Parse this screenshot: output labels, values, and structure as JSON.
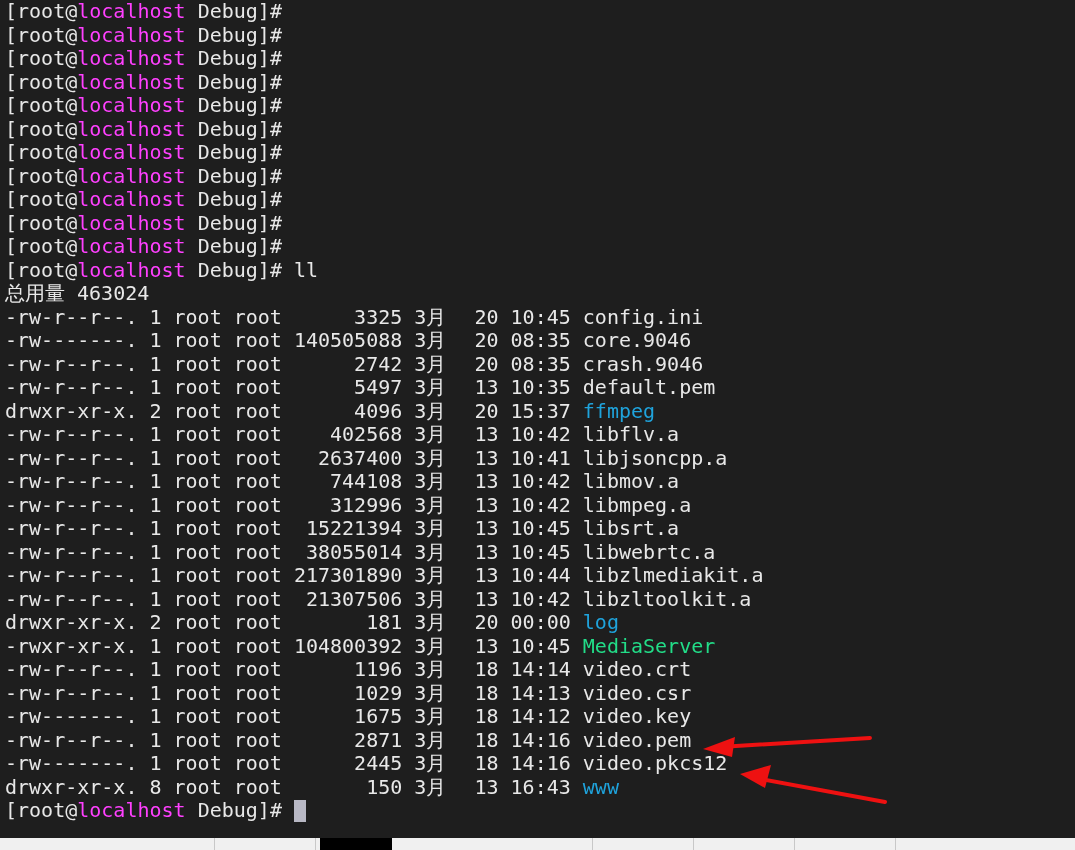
{
  "terminal": {
    "lines": [
      {
        "kind": "prompt",
        "before": "[root@",
        "host": "localhost",
        "after": " Debug]#"
      },
      {
        "kind": "prompt",
        "before": "[root@",
        "host": "localhost",
        "after": " Debug]#"
      },
      {
        "kind": "prompt",
        "before": "[root@",
        "host": "localhost",
        "after": " Debug]#"
      },
      {
        "kind": "prompt",
        "before": "[root@",
        "host": "localhost",
        "after": " Debug]#"
      },
      {
        "kind": "prompt",
        "before": "[root@",
        "host": "localhost",
        "after": " Debug]#"
      },
      {
        "kind": "prompt",
        "before": "[root@",
        "host": "localhost",
        "after": " Debug]#"
      },
      {
        "kind": "prompt",
        "before": "[root@",
        "host": "localhost",
        "after": " Debug]#"
      },
      {
        "kind": "prompt",
        "before": "[root@",
        "host": "localhost",
        "after": " Debug]#"
      },
      {
        "kind": "prompt",
        "before": "[root@",
        "host": "localhost",
        "after": " Debug]#"
      },
      {
        "kind": "prompt",
        "before": "[root@",
        "host": "localhost",
        "after": " Debug]#"
      },
      {
        "kind": "prompt",
        "before": "[root@",
        "host": "localhost",
        "after": " Debug]#"
      },
      {
        "kind": "prompt",
        "before": "[root@",
        "host": "localhost",
        "after": " Debug]#",
        "command": "ll"
      },
      {
        "kind": "total",
        "text": "总用量 463024"
      },
      {
        "kind": "file",
        "perms": "-rw-r--r--.",
        "links": "1",
        "owner": "root",
        "group": "root",
        "size": "3325",
        "month": "3月",
        "day": "20",
        "time": "10:45",
        "name": "config.ini",
        "color": "#e8e8e8"
      },
      {
        "kind": "file",
        "perms": "-rw-------.",
        "links": "1",
        "owner": "root",
        "group": "root",
        "size": "140505088",
        "month": "3月",
        "day": "20",
        "time": "08:35",
        "name": "core.9046",
        "color": "#e8e8e8"
      },
      {
        "kind": "file",
        "perms": "-rw-r--r--.",
        "links": "1",
        "owner": "root",
        "group": "root",
        "size": "2742",
        "month": "3月",
        "day": "20",
        "time": "08:35",
        "name": "crash.9046",
        "color": "#e8e8e8"
      },
      {
        "kind": "file",
        "perms": "-rw-r--r--.",
        "links": "1",
        "owner": "root",
        "group": "root",
        "size": "5497",
        "month": "3月",
        "day": "13",
        "time": "10:35",
        "name": "default.pem",
        "color": "#e8e8e8"
      },
      {
        "kind": "file",
        "perms": "drwxr-xr-x.",
        "links": "2",
        "owner": "root",
        "group": "root",
        "size": "4096",
        "month": "3月",
        "day": "20",
        "time": "15:37",
        "name": "ffmpeg",
        "color": "#1fa3dc"
      },
      {
        "kind": "file",
        "perms": "-rw-r--r--.",
        "links": "1",
        "owner": "root",
        "group": "root",
        "size": "402568",
        "month": "3月",
        "day": "13",
        "time": "10:42",
        "name": "libflv.a",
        "color": "#e8e8e8"
      },
      {
        "kind": "file",
        "perms": "-rw-r--r--.",
        "links": "1",
        "owner": "root",
        "group": "root",
        "size": "2637400",
        "month": "3月",
        "day": "13",
        "time": "10:41",
        "name": "libjsoncpp.a",
        "color": "#e8e8e8"
      },
      {
        "kind": "file",
        "perms": "-rw-r--r--.",
        "links": "1",
        "owner": "root",
        "group": "root",
        "size": "744108",
        "month": "3月",
        "day": "13",
        "time": "10:42",
        "name": "libmov.a",
        "color": "#e8e8e8"
      },
      {
        "kind": "file",
        "perms": "-rw-r--r--.",
        "links": "1",
        "owner": "root",
        "group": "root",
        "size": "312996",
        "month": "3月",
        "day": "13",
        "time": "10:42",
        "name": "libmpeg.a",
        "color": "#e8e8e8"
      },
      {
        "kind": "file",
        "perms": "-rw-r--r--.",
        "links": "1",
        "owner": "root",
        "group": "root",
        "size": "15221394",
        "month": "3月",
        "day": "13",
        "time": "10:45",
        "name": "libsrt.a",
        "color": "#e8e8e8"
      },
      {
        "kind": "file",
        "perms": "-rw-r--r--.",
        "links": "1",
        "owner": "root",
        "group": "root",
        "size": "38055014",
        "month": "3月",
        "day": "13",
        "time": "10:45",
        "name": "libwebrtc.a",
        "color": "#e8e8e8"
      },
      {
        "kind": "file",
        "perms": "-rw-r--r--.",
        "links": "1",
        "owner": "root",
        "group": "root",
        "size": "217301890",
        "month": "3月",
        "day": "13",
        "time": "10:44",
        "name": "libzlmediakit.a",
        "color": "#e8e8e8"
      },
      {
        "kind": "file",
        "perms": "-rw-r--r--.",
        "links": "1",
        "owner": "root",
        "group": "root",
        "size": "21307506",
        "month": "3月",
        "day": "13",
        "time": "10:42",
        "name": "libzltoolkit.a",
        "color": "#e8e8e8"
      },
      {
        "kind": "file",
        "perms": "drwxr-xr-x.",
        "links": "2",
        "owner": "root",
        "group": "root",
        "size": "181",
        "month": "3月",
        "day": "20",
        "time": "00:00",
        "name": "log",
        "color": "#1fa3dc"
      },
      {
        "kind": "file",
        "perms": "-rwxr-xr-x.",
        "links": "1",
        "owner": "root",
        "group": "root",
        "size": "104800392",
        "month": "3月",
        "day": "13",
        "time": "10:45",
        "name": "MediaServer",
        "color": "#22dd88"
      },
      {
        "kind": "file",
        "perms": "-rw-r--r--.",
        "links": "1",
        "owner": "root",
        "group": "root",
        "size": "1196",
        "month": "3月",
        "day": "18",
        "time": "14:14",
        "name": "video.crt",
        "color": "#e8e8e8"
      },
      {
        "kind": "file",
        "perms": "-rw-r--r--.",
        "links": "1",
        "owner": "root",
        "group": "root",
        "size": "1029",
        "month": "3月",
        "day": "18",
        "time": "14:13",
        "name": "video.csr",
        "color": "#e8e8e8"
      },
      {
        "kind": "file",
        "perms": "-rw-------.",
        "links": "1",
        "owner": "root",
        "group": "root",
        "size": "1675",
        "month": "3月",
        "day": "18",
        "time": "14:12",
        "name": "video.key",
        "color": "#e8e8e8"
      },
      {
        "kind": "file",
        "perms": "-rw-r--r--.",
        "links": "1",
        "owner": "root",
        "group": "root",
        "size": "2871",
        "month": "3月",
        "day": "18",
        "time": "14:16",
        "name": "video.pem",
        "color": "#e8e8e8"
      },
      {
        "kind": "file",
        "perms": "-rw-------.",
        "links": "1",
        "owner": "root",
        "group": "root",
        "size": "2445",
        "month": "3月",
        "day": "18",
        "time": "14:16",
        "name": "video.pkcs12",
        "color": "#e8e8e8"
      },
      {
        "kind": "file",
        "perms": "drwxr-xr-x.",
        "links": "8",
        "owner": "root",
        "group": "root",
        "size": "150",
        "month": "3月",
        "day": "13",
        "time": "16:43",
        "name": "www",
        "color": "#1fa3dc"
      },
      {
        "kind": "prompt",
        "before": "[root@",
        "host": "localhost",
        "after": " Debug]#",
        "cursor": true
      }
    ]
  }
}
